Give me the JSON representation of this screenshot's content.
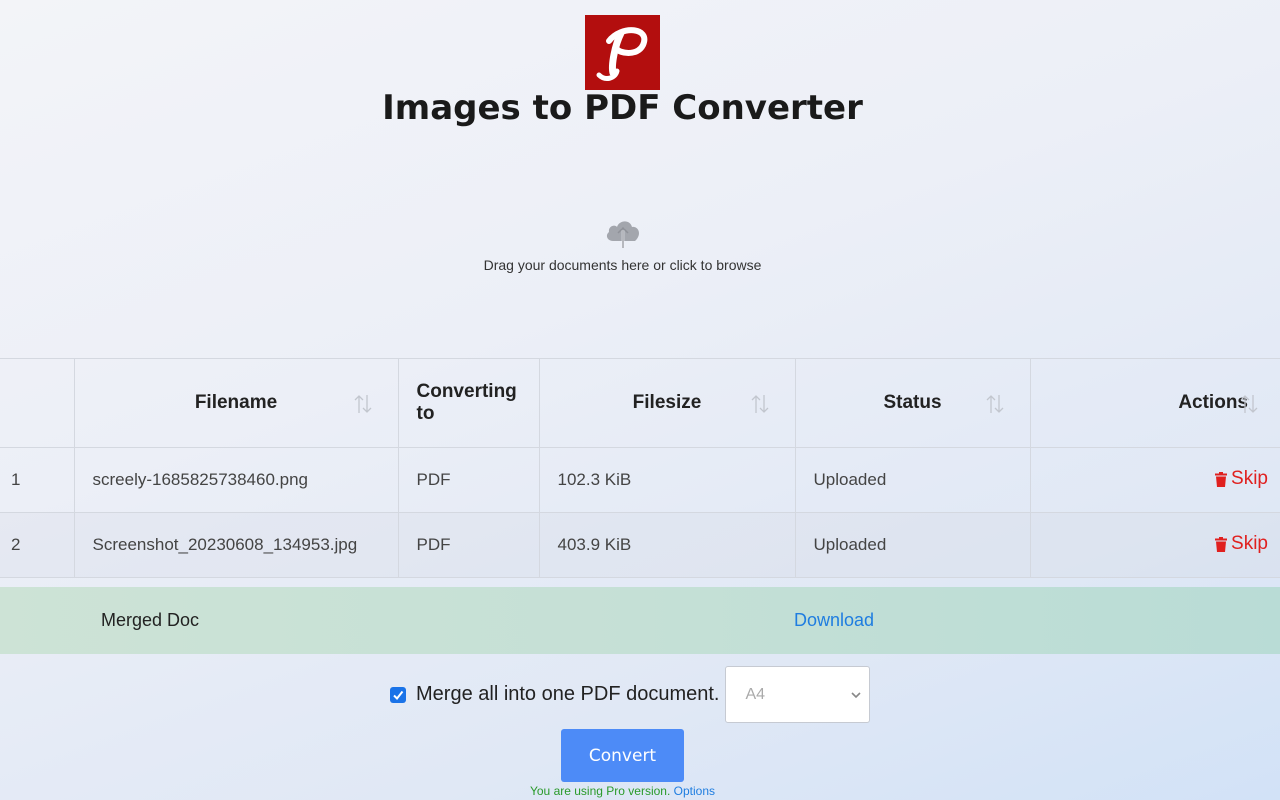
{
  "header": {
    "logo_icon": "pdf-p-logo-icon",
    "title": "Images to PDF Converter"
  },
  "dropzone": {
    "icon": "cloud-upload-icon",
    "text": "Drag your documents here or click to browse"
  },
  "table": {
    "columns": [
      {
        "label": "",
        "sortable": false
      },
      {
        "label": "Filename",
        "sortable": true
      },
      {
        "label": "Converting to",
        "sortable": false
      },
      {
        "label": "Filesize",
        "sortable": true
      },
      {
        "label": "Status",
        "sortable": true
      },
      {
        "label": "Actions",
        "sortable": true
      }
    ],
    "rows": [
      {
        "num": "1",
        "filename": "screely-1685825738460.png",
        "format": "PDF",
        "size": "102.3 KiB",
        "status": "Uploaded",
        "action": "Skip"
      },
      {
        "num": "2",
        "filename": "Screenshot_20230608_134953.jpg",
        "format": "PDF",
        "size": "403.9 KiB",
        "status": "Uploaded",
        "action": "Skip"
      }
    ]
  },
  "merged": {
    "label": "Merged Doc",
    "download": "Download"
  },
  "options": {
    "merge_checked": true,
    "merge_label": "Merge all into one PDF document.",
    "page_size": "A4"
  },
  "convert_label": "Convert",
  "footer": {
    "note": "You are using Pro version.",
    "options_link": "Options"
  },
  "colors": {
    "logo_bg": "#b30e0e",
    "accent": "#4d8bf7",
    "link": "#1f7de0",
    "danger": "#e0201f",
    "pro_note": "#2a9a2a"
  }
}
